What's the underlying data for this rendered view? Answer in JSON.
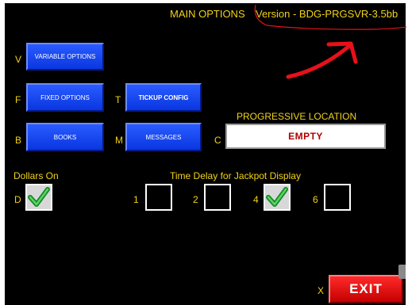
{
  "header": {
    "title": "MAIN OPTIONS",
    "version": "Version - BDG-PRGSVR-3.5bb"
  },
  "menu": [
    {
      "key": "V",
      "label": "VARIABLE OPTIONS"
    },
    {
      "key": "F",
      "label": "FIXED OPTIONS"
    },
    {
      "key": "T",
      "label": "TICKUP CONFIG"
    },
    {
      "key": "B",
      "label": "BOOKS"
    },
    {
      "key": "M",
      "label": "MESSAGES"
    }
  ],
  "progressive_location": {
    "label": "PROGRESSIVE LOCATION",
    "key": "C",
    "value": "EMPTY"
  },
  "dollars_on": {
    "label": "Dollars On",
    "key": "D",
    "checked": true
  },
  "time_delay": {
    "label": "Time Delay for Jackpot Display",
    "options": [
      {
        "key": "1",
        "checked": false
      },
      {
        "key": "2",
        "checked": false
      },
      {
        "key": "4",
        "checked": true
      },
      {
        "key": "6",
        "checked": false
      }
    ]
  },
  "exit": {
    "key": "X",
    "label": "EXIT"
  },
  "annotation_color": "#e8101a",
  "colors": {
    "text": "#f2d21a",
    "button": "#1447f0",
    "exit": "#e01010"
  }
}
